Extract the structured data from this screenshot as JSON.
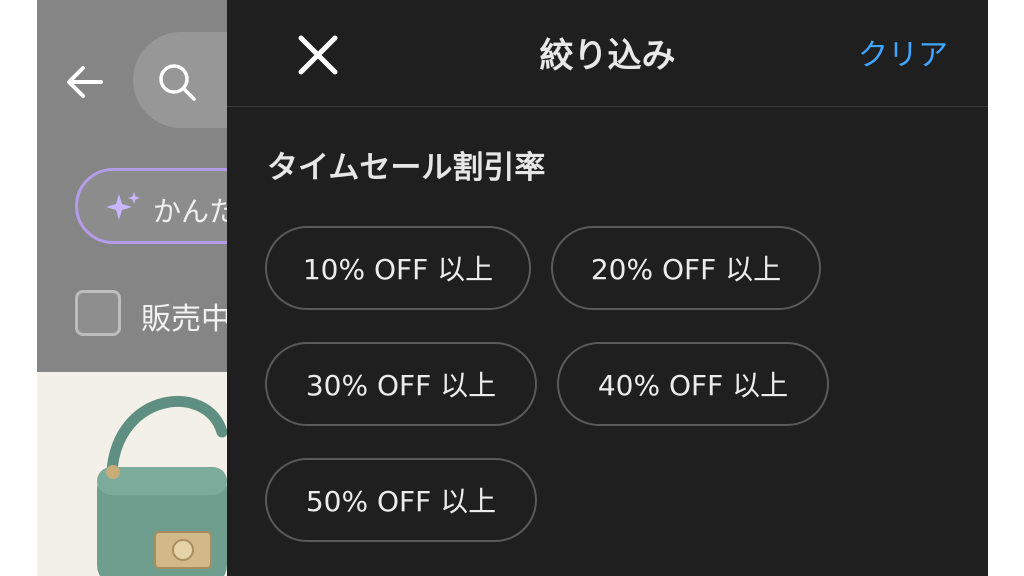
{
  "background": {
    "ai_search_label": "かんた",
    "checkbox_label": "販売中"
  },
  "panel": {
    "title": "絞り込み",
    "clear_label": "クリア"
  },
  "section": {
    "title": "タイムセール割引率",
    "options": [
      "10% OFF 以上",
      "20% OFF 以上",
      "30% OFF 以上",
      "40% OFF 以上",
      "50% OFF 以上"
    ]
  },
  "colors": {
    "panel_bg": "#1f1f1f",
    "accent": "#3ea6ff",
    "chip_border": "#5a5a5a"
  }
}
